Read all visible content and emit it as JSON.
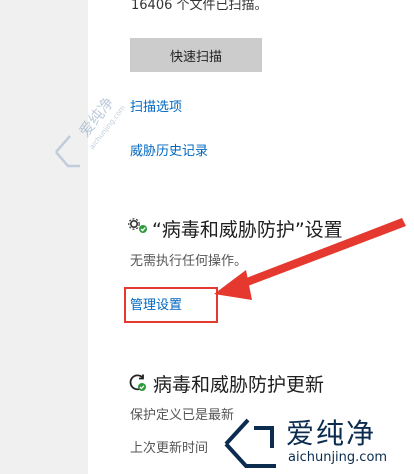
{
  "scan": {
    "status_text": "16406 个文件已扫描。",
    "quick_scan_label": "快速扫描",
    "scan_options_link": "扫描选项",
    "threat_history_link": "威胁历史记录"
  },
  "settings": {
    "title": "“病毒和威胁防护”设置",
    "subtitle": "无需执行任何操作。",
    "manage_link": "管理设置",
    "icon": "gear-check-icon"
  },
  "updates": {
    "title": "病毒和威胁防护更新",
    "definitions_status": "保护定义已是最新",
    "last_update": "上次更新时间"
  },
  "annotation": {
    "arrow_color": "#e5392f",
    "box_color": "#e5392f"
  },
  "watermark": {
    "name": "爱纯净",
    "url": "aichunjing.com",
    "faint_name": "爱纯净",
    "faint_url": "aichunjing.com"
  },
  "colors": {
    "link": "#0067c0",
    "button_bg": "#cccccc",
    "annotation": "#e5392f",
    "watermark": "#0c2c4f"
  }
}
